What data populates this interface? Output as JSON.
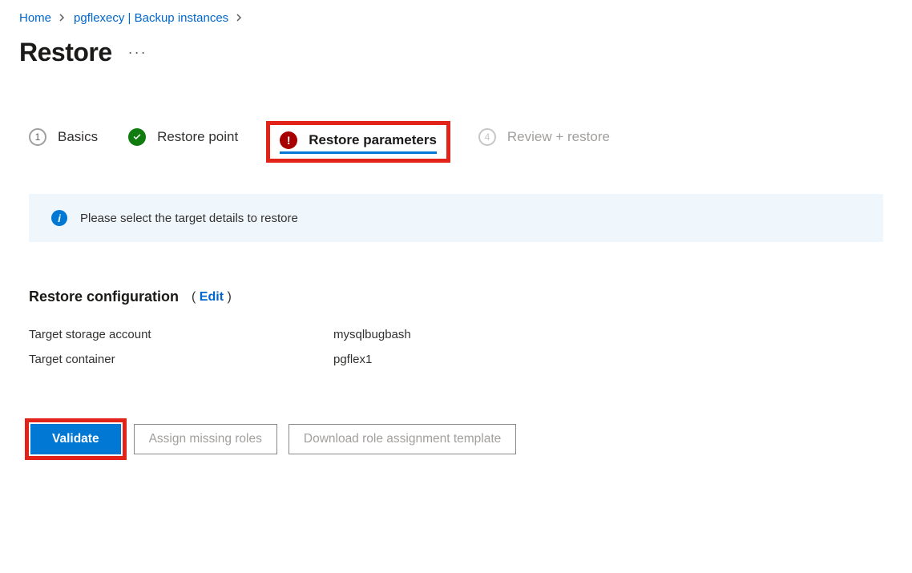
{
  "breadcrumb": {
    "home": "Home",
    "resource": "pgflexecy | Backup instances"
  },
  "page": {
    "title": "Restore",
    "more_menu": "···"
  },
  "steps": {
    "s1": {
      "num": "1",
      "label": "Basics"
    },
    "s2": {
      "label": "Restore point"
    },
    "s3": {
      "label": "Restore parameters",
      "error_mark": "!"
    },
    "s4": {
      "num": "4",
      "label": "Review + restore"
    }
  },
  "banner": {
    "text": "Please select the target details to restore",
    "info_glyph": "i"
  },
  "config": {
    "heading": "Restore configuration",
    "edit_label": "Edit",
    "rows": {
      "storage": {
        "key": "Target storage account",
        "val": "mysqlbugbash"
      },
      "container": {
        "key": "Target container",
        "val": "pgflex1"
      }
    }
  },
  "buttons": {
    "validate": "Validate",
    "assign_roles": "Assign missing roles",
    "download_template": "Download role assignment template"
  }
}
